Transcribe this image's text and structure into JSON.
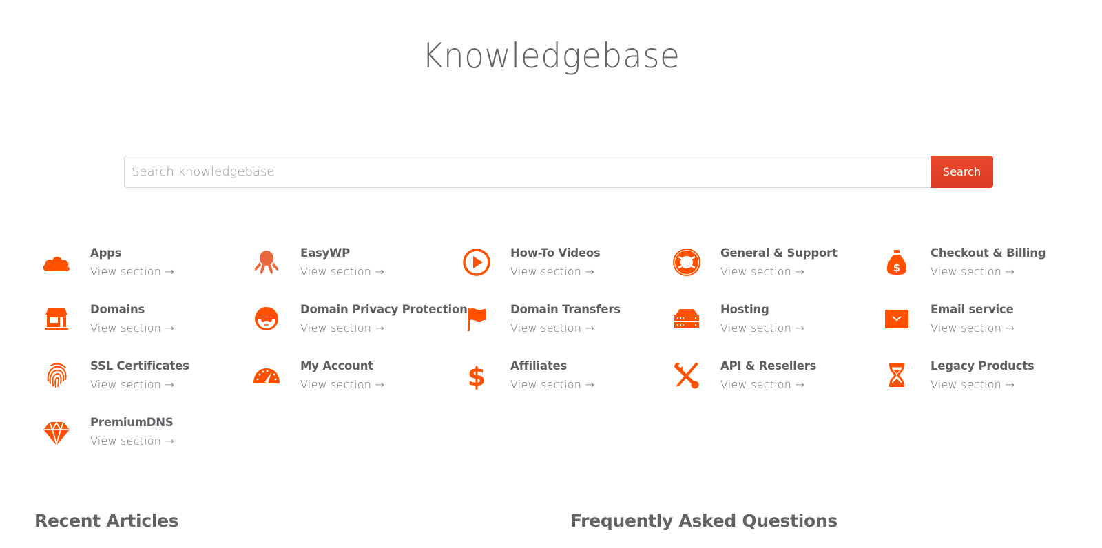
{
  "header": {
    "title": "Knowledgebase"
  },
  "search": {
    "placeholder": "Search knowledgebase",
    "value": "",
    "button_label": "Search"
  },
  "colors": {
    "accent": "#ff5100",
    "button": "#e2432a",
    "text": "#5f5f63"
  },
  "categories": [
    {
      "name": "Apps",
      "link": "View section →",
      "icon": "cloud-icon"
    },
    {
      "name": "EasyWP",
      "link": "View section →",
      "icon": "octopus-icon"
    },
    {
      "name": "How-To Videos",
      "link": "View section →",
      "icon": "play-icon"
    },
    {
      "name": "General & Support",
      "link": "View section →",
      "icon": "lifebuoy-icon"
    },
    {
      "name": "Checkout & Billing",
      "link": "View section →",
      "icon": "money-bag-icon"
    },
    {
      "name": "Domains",
      "link": "View section →",
      "icon": "storefront-icon"
    },
    {
      "name": "Domain Privacy Protection",
      "link": "View section →",
      "icon": "sunglasses-face-icon"
    },
    {
      "name": "Domain Transfers",
      "link": "View section →",
      "icon": "flag-icon"
    },
    {
      "name": "Hosting",
      "link": "View section →",
      "icon": "server-icon"
    },
    {
      "name": "Email service",
      "link": "View section →",
      "icon": "envelope-icon"
    },
    {
      "name": "SSL Certificates",
      "link": "View section →",
      "icon": "fingerprint-icon"
    },
    {
      "name": "My Account",
      "link": "View section →",
      "icon": "dashboard-gauge-icon"
    },
    {
      "name": "Affiliates",
      "link": "View section →",
      "icon": "dollar-icon"
    },
    {
      "name": "API & Resellers",
      "link": "View section →",
      "icon": "tools-icon"
    },
    {
      "name": "Legacy Products",
      "link": "View section →",
      "icon": "hourglass-icon"
    },
    {
      "name": "PremiumDNS",
      "link": "View section →",
      "icon": "diamond-icon"
    }
  ],
  "sections": {
    "recent_articles": "Recent Articles",
    "faq": "Frequently Asked Questions"
  }
}
